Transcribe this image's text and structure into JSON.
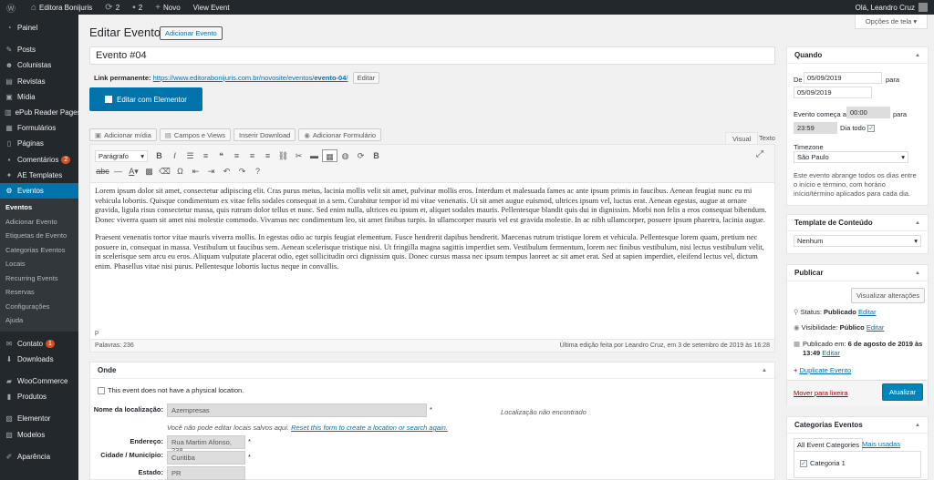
{
  "adminbar": {
    "site_name": "Editora Bonijuris",
    "updates_count": "2",
    "comments_count": "2",
    "new_label": "Novo",
    "view_label": "View Event",
    "greeting": "Olá, Leandro Cruz"
  },
  "sidebar": {
    "items": [
      {
        "label": "Painel",
        "icon": "dashboard-icon"
      },
      {
        "label": "Posts",
        "icon": "pin-icon"
      },
      {
        "label": "Colunistas",
        "icon": "users-icon"
      },
      {
        "label": "Revistas",
        "icon": "book-icon"
      },
      {
        "label": "Mídia",
        "icon": "media-icon"
      },
      {
        "label": "ePub Reader Pages",
        "icon": "epub-icon"
      },
      {
        "label": "Formulários",
        "icon": "forms-icon"
      },
      {
        "label": "Páginas",
        "icon": "pages-icon"
      },
      {
        "label": "Comentários",
        "icon": "comments-icon",
        "badge": "2"
      },
      {
        "label": "AE Templates",
        "icon": "templates-icon"
      },
      {
        "label": "Eventos",
        "icon": "events-icon"
      }
    ],
    "sub_items": [
      "Eventos",
      "Adicionar Evento",
      "Etiquetas de Evento",
      "Categorias Eventos",
      "Locais",
      "Recurring Events",
      "Reservas",
      "Configurações",
      "Ajuda"
    ],
    "items2": [
      {
        "label": "Contato",
        "icon": "mail-icon",
        "badge": "1"
      },
      {
        "label": "Downloads",
        "icon": "download-icon"
      },
      {
        "label": "WooCommerce",
        "icon": "woo-icon"
      },
      {
        "label": "Produtos",
        "icon": "products-icon"
      },
      {
        "label": "Elementor",
        "icon": "elementor-icon"
      },
      {
        "label": "Modelos",
        "icon": "folder-icon"
      },
      {
        "label": "Aparência",
        "icon": "brush-icon"
      }
    ]
  },
  "page": {
    "title": "Editar Evento",
    "add_new": "Adicionar Evento",
    "screen_options": "Opções de tela",
    "event_title": "Evento #04",
    "permalink_label": "Link permanente:",
    "permalink_base": "https://www.editorabonijuris.com.br/novosite/eventos/",
    "permalink_slug": "evento-04",
    "permalink_tail": "/",
    "edit_label": "Editar",
    "elementor_label": "Editar com Elementor"
  },
  "media_buttons": [
    "Adicionar mídia",
    "Campos e Views",
    "Inserir Download",
    "Adicionar Formulário"
  ],
  "editor_tabs": {
    "visual": "Visual",
    "text": "Texto"
  },
  "editor": {
    "format": "Parágrafo",
    "paragraph1": "Lorem ipsum dolor sit amet, consectetur adipiscing elit. Cras purus metus, lacinia mollis velit sit amet, pulvinar mollis eros. Interdum et malesuada fames ac ante ipsum primis in faucibus. Aenean feugiat nunc eu mi vehicula lobortis. Quisque condimentum ex vitae felis sodales consequat in a sem. Curabitur tempor id mi vitae venenatis. Ut sit amet augue euismod, ultrices ipsum vel, luctus erat. Aenean egestas, augue at ornare gravida, ligula risus consectetur massa, quis rutrum dolor tellus et nunc. Sed enim nulla, ultrices eu ipsum et, aliquet sodales mauris. Pellentesque blandit quis dui in dignissim. Morbi non felis a eros consequat bibendum. Donec viverra quam sit amet nisi molestie commodo. Vivamus nec condimentum leo, sit amet finibus turpis. In ullamcorper mauris vel est gravida molestie. In ac nibh ullamcorper, posuere ipsum pharetra, lacinia augue.",
    "paragraph2": "Praesent venenatis tortor vitae mauris viverra mollis. In egestas odio ac turpis feugiat elementum. Fusce hendrerit dapibus hendrerit. Maecenas rutrum tristique lorem et vehicula. Pellentesque lorem quam, pretium nec posuere in, consequat in massa. Vestibulum ut faucibus sem. Aenean scelerisque tristique nisi. Ut fringilla magna sagittis imperdiet sem. Vestibulum fermentum, lorem nec finibus vestibulum, nisi lectus vestibulum velit, in scelerisque sem arcu eu eros. Aliquam vulputate placerat odio, eget sollicitudin orci dignissim quis. Donec cursus massa nec ipsum tempus laoreet ac sit amet erat. Sed at sapien imperdiet, eleifend lectus vel, dictum enim. Phasellus vitae nisi purus. Pellentesque lobortis luctus neque in convallis.",
    "path": "p",
    "word_count": "Palavras: 236",
    "last_edit": "Última edição feita por Leandro Cruz, em 3 de setembro de 2019 às 16:28"
  },
  "onde": {
    "title": "Onde",
    "no_location": "This event does not have a physical location.",
    "name_label": "Nome da localização:",
    "name_value": "Azempresas",
    "not_found": "Localização não encontrado",
    "cannot_edit": "Você não pode editar locais salvos aqui.",
    "reset_link": "Reset this form to create a location or search again.",
    "address_label": "Endereço:",
    "address_value": "Rua Martim Afonso, 238",
    "city_label": "Cidade / Município:",
    "city_value": "Curitiba",
    "state_label": "Estado:",
    "state_value": "PR",
    "asterisk": "*"
  },
  "quando": {
    "title": "Quando",
    "from": "De",
    "date_start": "05/09/2019",
    "to": "para",
    "date_end": "05/09/2019",
    "starts_at": "Evento começa as",
    "time_start": "00:00",
    "to2": "para",
    "time_end": "23:59",
    "all_day": "Dia todo",
    "timezone_label": "Timezone",
    "timezone": "São Paulo",
    "note": "Este evento abrange todos os dias entre o início e término, com horário início/término aplicados para cada dia."
  },
  "template": {
    "title": "Template de Conteúdo",
    "value": "Nenhum"
  },
  "publicar": {
    "title": "Publicar",
    "preview": "Visualizar alterações",
    "status_label": "Status:",
    "status_value": "Publicado",
    "visibility_label": "Visibilidade:",
    "visibility_value": "Público",
    "published_label": "Publicado em:",
    "published_value": "6 de agosto de 2019 às 13:49",
    "edit": "Editar",
    "duplicate": "Duplicate Evento",
    "trash": "Mover para lixeira",
    "update": "Atualizar"
  },
  "categorias": {
    "title": "Categorias Eventos",
    "tab_all": "All Event Categories",
    "tab_used": "Mais usadas",
    "item": "Categoria 1"
  },
  "colors": {
    "accent": "#0073aa",
    "adminbar": "#23282d",
    "badge": "#d54e21"
  }
}
